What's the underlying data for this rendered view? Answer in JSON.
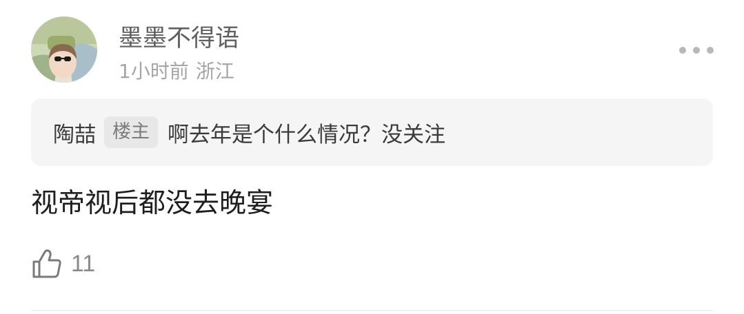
{
  "comment": {
    "username": "墨墨不得语",
    "time": "1小时前",
    "location": "浙江",
    "more_icon": "more-horizontal-icon",
    "quote": {
      "author": "陶喆",
      "badge": "楼主",
      "text": "啊去年是个什么情况？没关注"
    },
    "content": "视帝视后都没去晚宴",
    "like_icon": "thumbs-up-icon",
    "like_count": "11"
  },
  "colors": {
    "username": "#5f5f5f",
    "meta": "#a5a5a5",
    "quote_background": "#f5f5f5",
    "badge_background": "#e8e8e8",
    "content": "#1e1e1e",
    "like_count": "#8a8a8a"
  }
}
